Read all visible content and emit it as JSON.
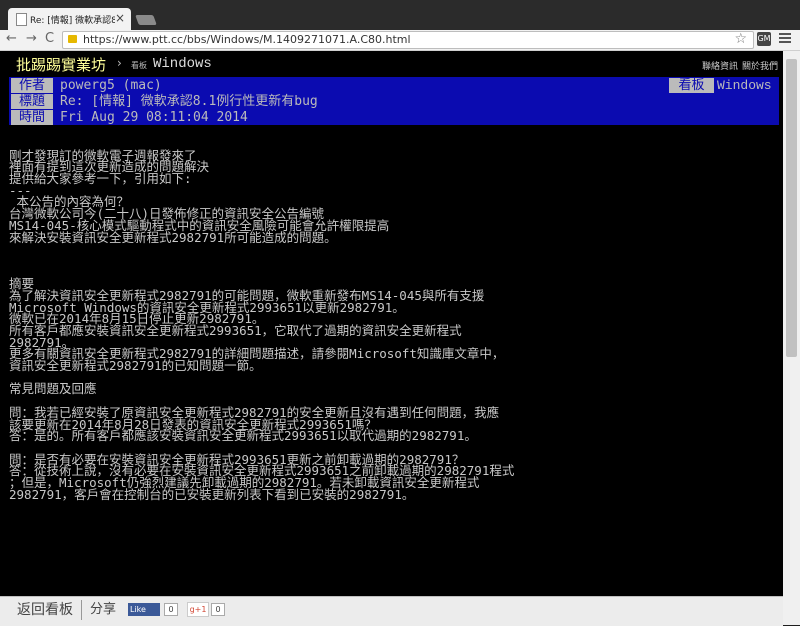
{
  "browser": {
    "tab_title": "Re: [情報] 微軟承認8.1例...",
    "tab_close": "×",
    "back": "←",
    "forward": "→",
    "reload": "C",
    "url": "https://www.ptt.cc/bbs/Windows/M.1409271071.A.C80.html",
    "star": "☆",
    "extension": "GM"
  },
  "site": {
    "brand": "批踢踢實業坊",
    "crumb_sep": "›",
    "crumb_small": "看板",
    "board": "Windows",
    "links": [
      "聯絡資訊",
      "關於我們"
    ]
  },
  "article": {
    "author_label": "作者",
    "author": "powerg5 (mac)",
    "board_label": "看板",
    "board": "Windows",
    "title_label": "標題",
    "title": "Re: [情報] 微軟承認8.1例行性更新有bug",
    "time_label": "時間",
    "time": "Fri Aug 29 08:11:04 2014",
    "lines": [
      "",
      "剛才發現訂的微軟電子週報發來了",
      "裡面有提到這次更新造成的問題解決",
      "提供給大家參考一下，引用如下:",
      "---",
      " 本公告的內容為何？",
      "台灣微軟公司今(二十八)日發佈修正的資訊安全公告編號",
      "MS14-045-核心模式驅動程式中的資訊安全風險可能會允許權限提高",
      "來解決安裝資訊安全更新程式2982791所可能造成的問題。",
      "",
      "",
      "",
      "摘要",
      "為了解決資訊安全更新程式2982791的可能問題，微軟重新發布MS14-045與所有支援",
      "Microsoft Windows的資訊安全更新程式2993651以更新2982791。",
      "微軟已在2014年8月15日停止更新2982791。",
      "所有客戶都應安裝資訊安全更新程式2993651，它取代了過期的資訊安全更新程式",
      "2982791。",
      "更多有關資訊安全更新程式2982791的詳細問題描述，請參閱Microsoft知識庫文章中，",
      "資訊安全更新程式2982791的已知問題一節。",
      "",
      "常見問題及回應",
      "",
      "問：我若已經安裝了原資訊安全更新程式2982791的安全更新且沒有遇到任何問題，我應",
      "該要更新在2014年8月28日發表的資訊安全更新程式2993651嗎？",
      "答：是的。所有客戶都應該安裝資訊安全更新程式2993651以取代過期的2982791。",
      "",
      "問：是否有必要在安裝資訊安全更新程式2993651更新之前卸載過期的2982791？",
      "答：從技術上說，沒有必要在安裝資訊安全更新程式2993651之前卸載過期的2982791程式",
      "；但是，Microsoft仍強烈建議先卸載過期的2982791。若未卸載資訊安全更新程式",
      "2982791，客戶會在控制台的已安裝更新列表下看到已安裝的2982791。"
    ]
  },
  "footer": {
    "back_label": "返回看板",
    "share_label": "分享",
    "fb_label": "Like",
    "fb_count": "0",
    "gplus_label": "g+1",
    "gplus_count": "0"
  },
  "colors": {
    "meta_bg": "#0b0bb0",
    "meta_label_bg": "#bbbbbb",
    "brand": "#ffff99",
    "text": "#c8c8c8"
  }
}
